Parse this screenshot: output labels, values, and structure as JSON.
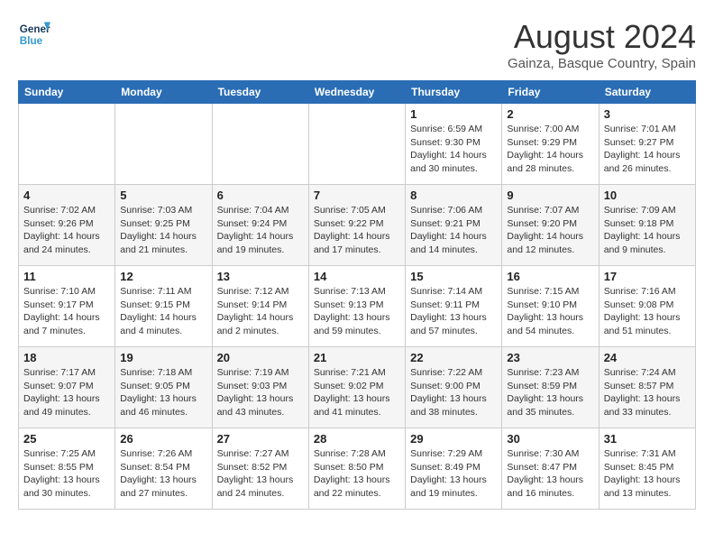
{
  "header": {
    "logo_line1": "General",
    "logo_line2": "Blue",
    "month": "August 2024",
    "location": "Gainza, Basque Country, Spain"
  },
  "days_of_week": [
    "Sunday",
    "Monday",
    "Tuesday",
    "Wednesday",
    "Thursday",
    "Friday",
    "Saturday"
  ],
  "weeks": [
    [
      {
        "day": "",
        "info": ""
      },
      {
        "day": "",
        "info": ""
      },
      {
        "day": "",
        "info": ""
      },
      {
        "day": "",
        "info": ""
      },
      {
        "day": "1",
        "info": "Sunrise: 6:59 AM\nSunset: 9:30 PM\nDaylight: 14 hours\nand 30 minutes."
      },
      {
        "day": "2",
        "info": "Sunrise: 7:00 AM\nSunset: 9:29 PM\nDaylight: 14 hours\nand 28 minutes."
      },
      {
        "day": "3",
        "info": "Sunrise: 7:01 AM\nSunset: 9:27 PM\nDaylight: 14 hours\nand 26 minutes."
      }
    ],
    [
      {
        "day": "4",
        "info": "Sunrise: 7:02 AM\nSunset: 9:26 PM\nDaylight: 14 hours\nand 24 minutes."
      },
      {
        "day": "5",
        "info": "Sunrise: 7:03 AM\nSunset: 9:25 PM\nDaylight: 14 hours\nand 21 minutes."
      },
      {
        "day": "6",
        "info": "Sunrise: 7:04 AM\nSunset: 9:24 PM\nDaylight: 14 hours\nand 19 minutes."
      },
      {
        "day": "7",
        "info": "Sunrise: 7:05 AM\nSunset: 9:22 PM\nDaylight: 14 hours\nand 17 minutes."
      },
      {
        "day": "8",
        "info": "Sunrise: 7:06 AM\nSunset: 9:21 PM\nDaylight: 14 hours\nand 14 minutes."
      },
      {
        "day": "9",
        "info": "Sunrise: 7:07 AM\nSunset: 9:20 PM\nDaylight: 14 hours\nand 12 minutes."
      },
      {
        "day": "10",
        "info": "Sunrise: 7:09 AM\nSunset: 9:18 PM\nDaylight: 14 hours\nand 9 minutes."
      }
    ],
    [
      {
        "day": "11",
        "info": "Sunrise: 7:10 AM\nSunset: 9:17 PM\nDaylight: 14 hours\nand 7 minutes."
      },
      {
        "day": "12",
        "info": "Sunrise: 7:11 AM\nSunset: 9:15 PM\nDaylight: 14 hours\nand 4 minutes."
      },
      {
        "day": "13",
        "info": "Sunrise: 7:12 AM\nSunset: 9:14 PM\nDaylight: 14 hours\nand 2 minutes."
      },
      {
        "day": "14",
        "info": "Sunrise: 7:13 AM\nSunset: 9:13 PM\nDaylight: 13 hours\nand 59 minutes."
      },
      {
        "day": "15",
        "info": "Sunrise: 7:14 AM\nSunset: 9:11 PM\nDaylight: 13 hours\nand 57 minutes."
      },
      {
        "day": "16",
        "info": "Sunrise: 7:15 AM\nSunset: 9:10 PM\nDaylight: 13 hours\nand 54 minutes."
      },
      {
        "day": "17",
        "info": "Sunrise: 7:16 AM\nSunset: 9:08 PM\nDaylight: 13 hours\nand 51 minutes."
      }
    ],
    [
      {
        "day": "18",
        "info": "Sunrise: 7:17 AM\nSunset: 9:07 PM\nDaylight: 13 hours\nand 49 minutes."
      },
      {
        "day": "19",
        "info": "Sunrise: 7:18 AM\nSunset: 9:05 PM\nDaylight: 13 hours\nand 46 minutes."
      },
      {
        "day": "20",
        "info": "Sunrise: 7:19 AM\nSunset: 9:03 PM\nDaylight: 13 hours\nand 43 minutes."
      },
      {
        "day": "21",
        "info": "Sunrise: 7:21 AM\nSunset: 9:02 PM\nDaylight: 13 hours\nand 41 minutes."
      },
      {
        "day": "22",
        "info": "Sunrise: 7:22 AM\nSunset: 9:00 PM\nDaylight: 13 hours\nand 38 minutes."
      },
      {
        "day": "23",
        "info": "Sunrise: 7:23 AM\nSunset: 8:59 PM\nDaylight: 13 hours\nand 35 minutes."
      },
      {
        "day": "24",
        "info": "Sunrise: 7:24 AM\nSunset: 8:57 PM\nDaylight: 13 hours\nand 33 minutes."
      }
    ],
    [
      {
        "day": "25",
        "info": "Sunrise: 7:25 AM\nSunset: 8:55 PM\nDaylight: 13 hours\nand 30 minutes."
      },
      {
        "day": "26",
        "info": "Sunrise: 7:26 AM\nSunset: 8:54 PM\nDaylight: 13 hours\nand 27 minutes."
      },
      {
        "day": "27",
        "info": "Sunrise: 7:27 AM\nSunset: 8:52 PM\nDaylight: 13 hours\nand 24 minutes."
      },
      {
        "day": "28",
        "info": "Sunrise: 7:28 AM\nSunset: 8:50 PM\nDaylight: 13 hours\nand 22 minutes."
      },
      {
        "day": "29",
        "info": "Sunrise: 7:29 AM\nSunset: 8:49 PM\nDaylight: 13 hours\nand 19 minutes."
      },
      {
        "day": "30",
        "info": "Sunrise: 7:30 AM\nSunset: 8:47 PM\nDaylight: 13 hours\nand 16 minutes."
      },
      {
        "day": "31",
        "info": "Sunrise: 7:31 AM\nSunset: 8:45 PM\nDaylight: 13 hours\nand 13 minutes."
      }
    ]
  ]
}
